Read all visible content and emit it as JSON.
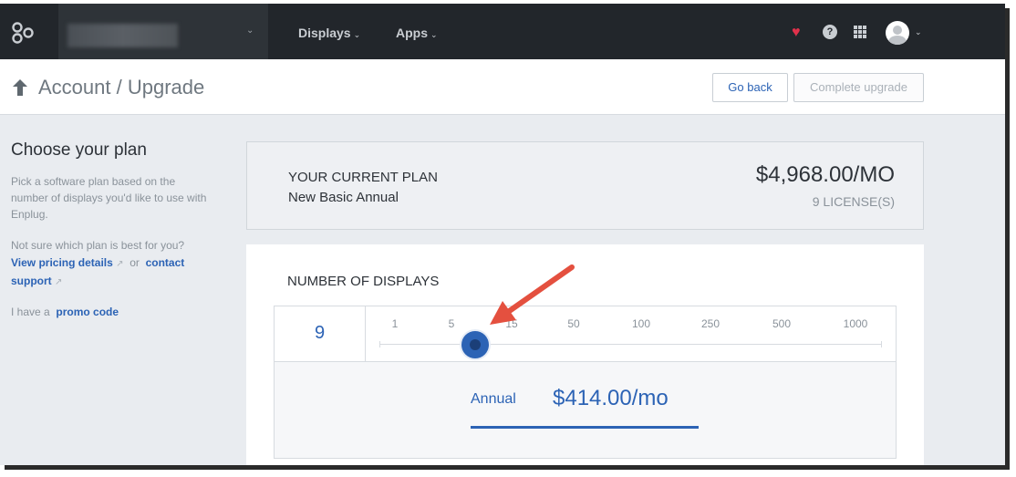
{
  "nav": {
    "account_chevron": "⌄",
    "items": [
      {
        "label": "Displays",
        "chevron": "⌄"
      },
      {
        "label": "Apps",
        "chevron": "⌄"
      }
    ],
    "icons": [
      "logo-icon",
      "heart-icon",
      "help-icon",
      "apps-grid-icon",
      "avatar",
      "chevron-down-icon"
    ],
    "help_glyph": "?",
    "heart_glyph": "♥",
    "avatar_chevron": "⌄",
    "accent_heart": "#e0314b"
  },
  "header": {
    "title": "Account / Upgrade",
    "go_back": "Go back",
    "complete_upgrade": "Complete upgrade"
  },
  "sidebar": {
    "heading": "Choose your plan",
    "description": "Pick a software plan based on the number of displays you'd like to use with Enplug.",
    "help_prefix": "Not sure which plan is best for you?",
    "pricing_link": "View pricing details",
    "or": "or",
    "contact_link_1": "contact",
    "contact_link_2": "support",
    "promo_prefix": "I have a",
    "promo_link": "promo code"
  },
  "current_plan": {
    "label": "YOUR CURRENT PLAN",
    "name": "New Basic Annual",
    "price": "$4,968.00/MO",
    "licenses": "9 LICENSE(S)"
  },
  "displays": {
    "heading": "NUMBER OF DISPLAYS",
    "count": "9",
    "ticks": [
      "1",
      "5",
      "15",
      "50",
      "100",
      "250",
      "500",
      "1000"
    ],
    "selected_value": 9,
    "billing_label": "Annual",
    "monthly_price": "$414.00/mo"
  },
  "colors": {
    "accent": "#2c63b5",
    "nav_bg": "#22262b",
    "annotation": "#e4503f"
  }
}
